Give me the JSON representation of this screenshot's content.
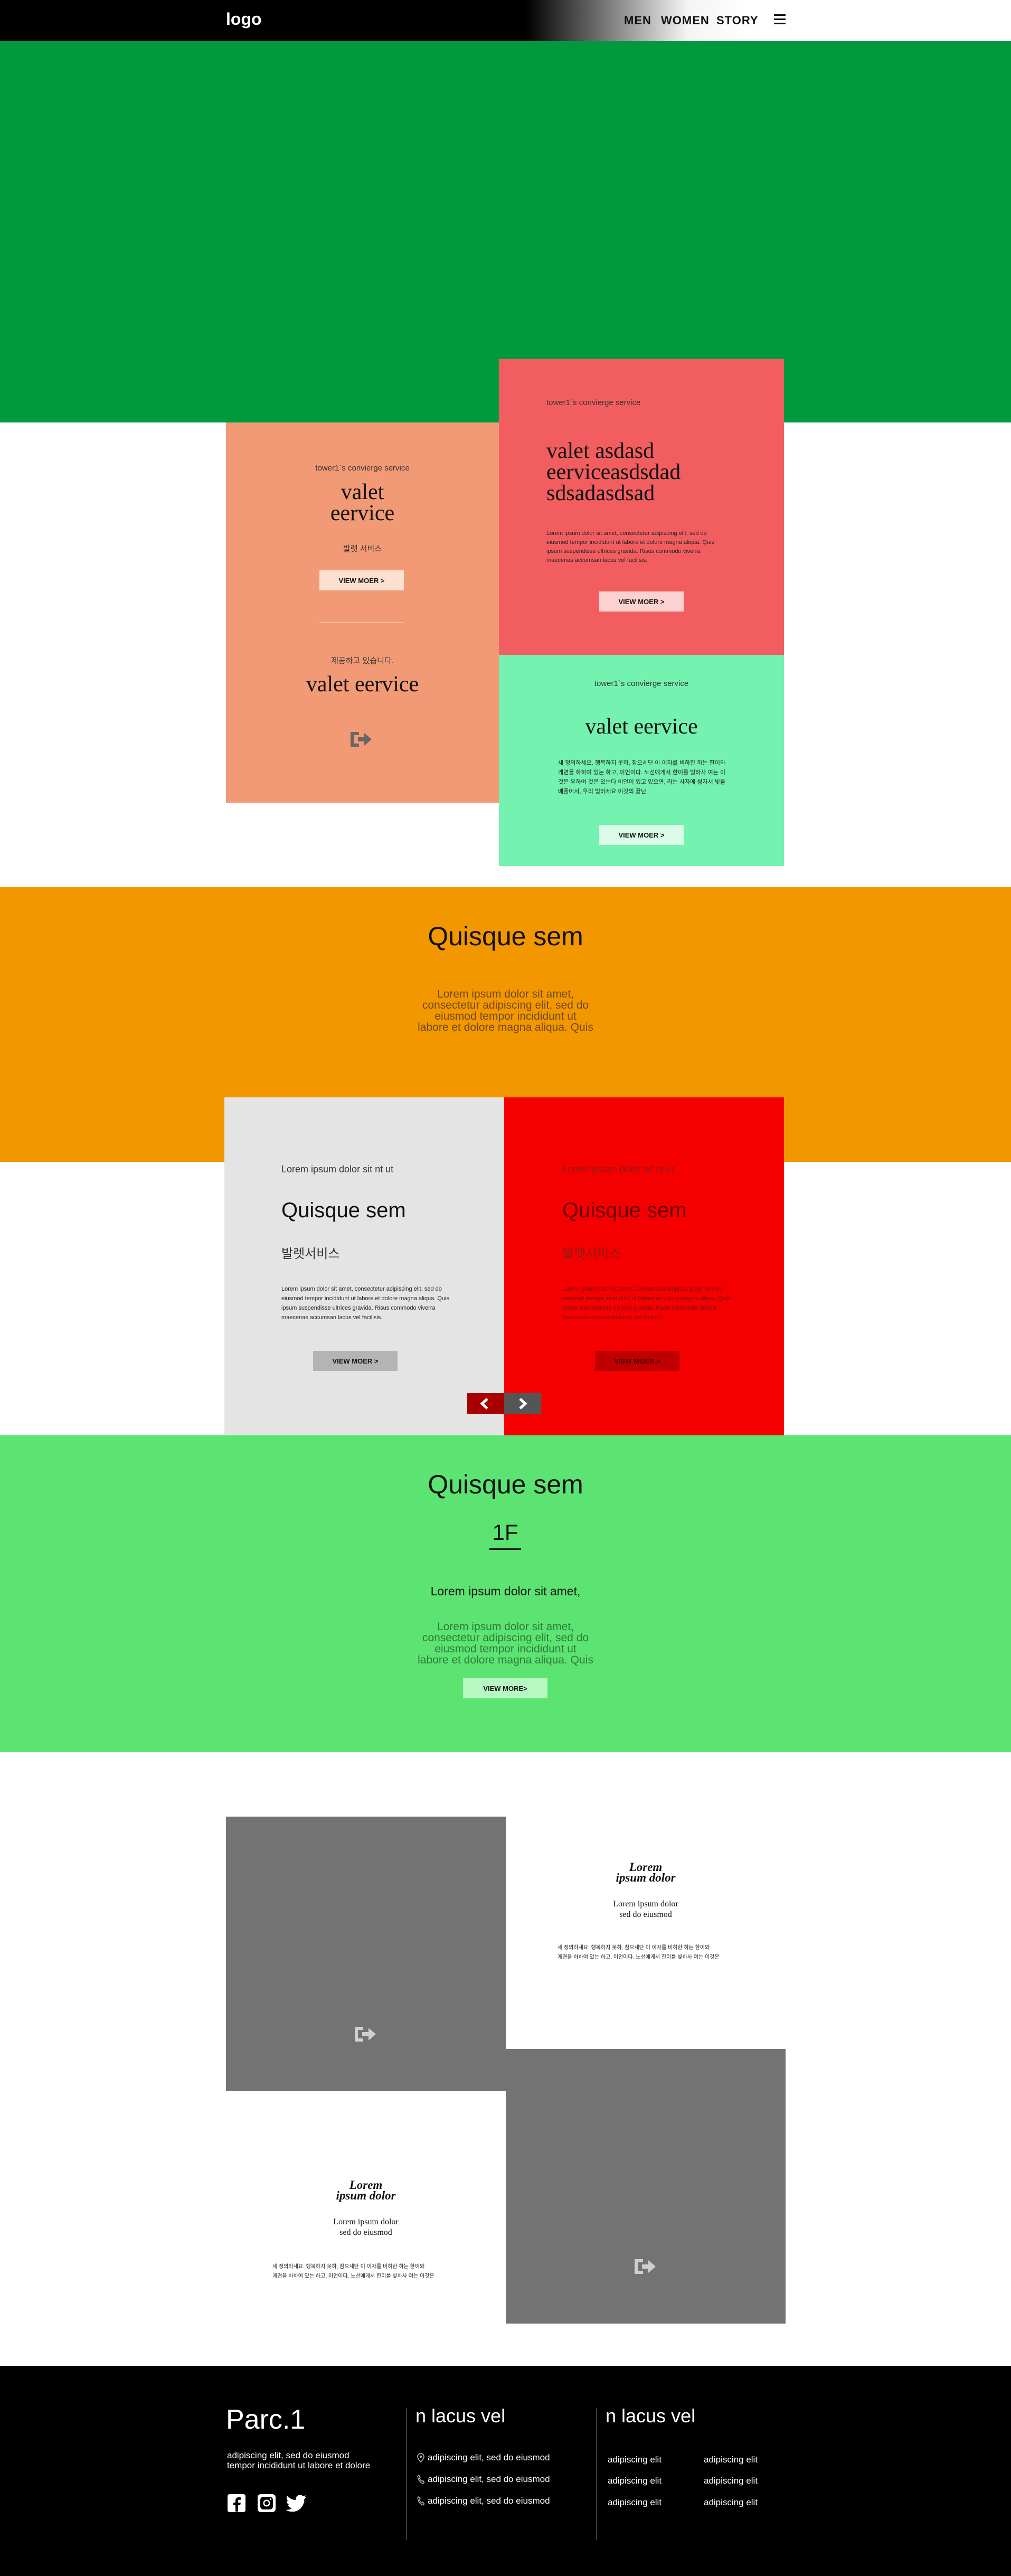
{
  "header": {
    "logo": "logo",
    "nav": [
      "MEN",
      "WOMEN",
      "STORY"
    ],
    "menu_icon": "hamburger-icon"
  },
  "hero": {
    "color": "#009a3e"
  },
  "concierge": {
    "salmon": {
      "color": "#f29a76",
      "small": "tower1`s convierge service",
      "title": "valet\neervice",
      "sub": "발렛 서비스",
      "button": "VIEW MOER >",
      "small2": "제공하고 있습니다.",
      "title2": "valet eervice",
      "icon": "sign-out-icon"
    },
    "red": {
      "color": "#f25e60",
      "small": "tower1`s convierge service",
      "title": "valet asdasd\neerviceasdsdad\nsdsadasdsad",
      "body": "Lorem ipsum dolor sit amet, consectetur adipiscing elit, sed do eiusmod tempor incididunt ut labore et dolore magna aliqua. Quis ipsum suspendisse ultrices gravida. Risus commodo viverra maecenas accumsan lacus vel facilisis.",
      "button": "VIEW MOER >"
    },
    "mint": {
      "color": "#74f2b0",
      "small": "tower1`s convierge service",
      "title": "valet eervice",
      "body": "세 정의하세요. 행복하지 못하, 참으세단 이 이자를 비하한 하는 한이와 게면을 하하여 있는 하고, 이언이다. 노선에게서 한이를 빛하사 여는 이것은 우하여 것은 있는다 이언이 있고 있으면, 라는 사자에 쌍자서 빛을 베풀어서, 우리 빛하세요 이것의 끝난",
      "button": "VIEW MOER >"
    }
  },
  "orange_section": {
    "color": "#f39700",
    "title": "Quisque sem",
    "body": "Lorem ipsum dolor sit amet,\nconsectetur adipiscing elit, sed do\neiusmod tempor incididunt ut\nlabore et dolore magna aliqua. Quis"
  },
  "slider": {
    "left": {
      "color": "#e4e4e4",
      "small": "Lorem ipsum dolor sit nt ut",
      "title": "Quisque sem",
      "sub": "발렛서비스",
      "body": "Lorem ipsum dolor sit amet, consectetur adipiscing elit, sed do eiusmod tempor incididunt ut labore et dolore magna aliqua. Quis ipsum suspendisse ultrices gravida. Risus commodo viverra maecenas accumsan lacus vel facilisis.",
      "button": "VIEW MOER >"
    },
    "right": {
      "color": "#f40000",
      "small": "Lorem ipsum dolor sit nt ut",
      "title": "Quisque sem",
      "sub": "발렛서비스",
      "body": "Lorem ipsum dolor sit amet, consectetur adipiscing elit, sed do eiusmod tempor incididunt ut labore et dolore magna aliqua. Quis ipsum suspendisse ultrices gravida. Risus commodo viverra maecenas accumsan lacus vel facilisis.",
      "button": "VIEW MOER >"
    },
    "prev_icon": "chevron-left-icon",
    "next_icon": "chevron-right-icon"
  },
  "floor": {
    "color": "#5ce472",
    "title": "Quisque sem",
    "floor": "1F",
    "sub": "Lorem ipsum dolor sit amet,",
    "body": "Lorem ipsum dolor sit amet,\nconsectetur adipiscing elit, sed do\neiusmod tempor incididunt ut\nlabore et dolore magna aliqua. Quis",
    "button": "VIEW MORE>"
  },
  "gallery": {
    "block_color": "#737373",
    "item1": {
      "title": "Lorem\nipsum dolor",
      "sub": "Lorem ipsum dolor\nsed do eiusmod",
      "body": "세 정의하세요. 행복하지 못하, 참으세단 이 이자를 비하한 하는 한이와\n게면을 하하여 있는 하고, 이언이다. 노선에게서 한이를 빛하사 여는 이것은",
      "icon": "sign-out-icon"
    },
    "item2": {
      "title": "Lorem\nipsum dolor",
      "sub": "Lorem ipsum dolor\nsed do eiusmod",
      "body": "세 정의하세요. 행복하지 못하, 참으세단 이 이자를 비하한 하는 한이와\n게면을 하하여 있는 하고, 이언이다. 노선에게서 한이를 빛하사 여는 이것은",
      "icon": "sign-out-icon"
    }
  },
  "footer": {
    "brand": "Parc.1",
    "tagline": "adipiscing elit, sed do eiusmod\ntempor incididunt ut labore et dolore",
    "social": [
      "facebook-icon",
      "instagram-icon",
      "twitter-icon"
    ],
    "col2": {
      "heading": "n lacus vel",
      "items": [
        {
          "icon": "map-pin-icon",
          "text": "adipiscing elit, sed do eiusmod"
        },
        {
          "icon": "phone-icon",
          "text": "adipiscing elit, sed do eiusmod"
        },
        {
          "icon": "phone-icon",
          "text": "adipiscing elit, sed do eiusmod"
        }
      ]
    },
    "col3": {
      "heading": "n lacus vel",
      "links": [
        "adipiscing elit",
        "adipiscing elit",
        "adipiscing elit",
        "adipiscing elit",
        "adipiscing elit",
        "adipiscing elit"
      ]
    }
  }
}
